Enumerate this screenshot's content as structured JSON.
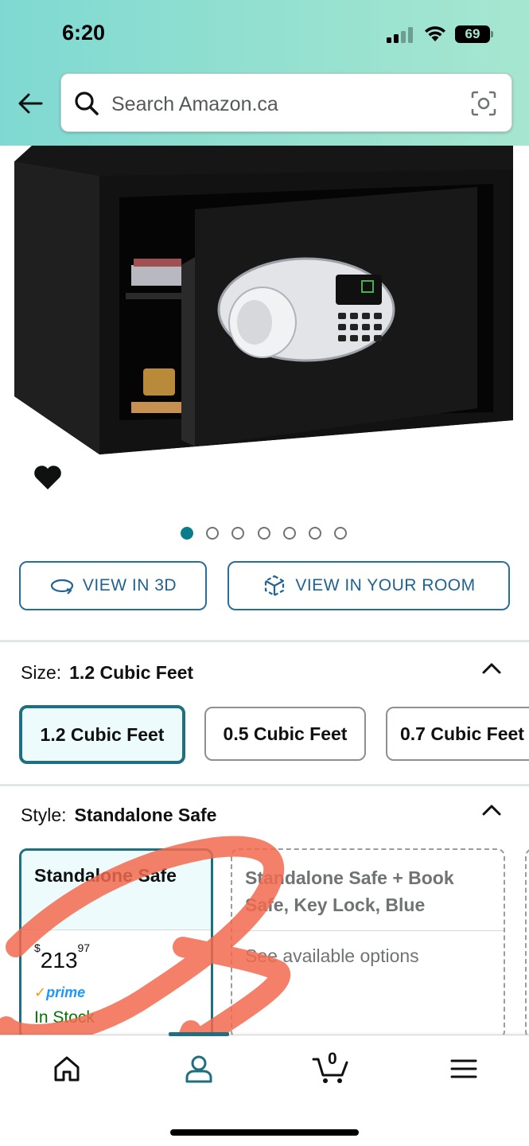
{
  "status_bar": {
    "time": "6:20",
    "battery": "69"
  },
  "search": {
    "placeholder": "Search Amazon.ca"
  },
  "gallery": {
    "total_images": 7,
    "active_index": 0
  },
  "actions": {
    "view_3d": "VIEW IN 3D",
    "view_room": "VIEW IN YOUR ROOM"
  },
  "size_section": {
    "label": "Size:",
    "selected": "1.2 Cubic Feet",
    "options": [
      "1.2 Cubic Feet",
      "0.5 Cubic Feet",
      "0.7 Cubic Feet"
    ]
  },
  "style_section": {
    "label": "Style:",
    "selected": "Standalone Safe",
    "options": [
      {
        "name": "Standalone Safe",
        "price_symbol": "$",
        "price_whole": "213",
        "price_fraction": "97",
        "prime": "prime",
        "stock": "In Stock"
      },
      {
        "name": "Standalone Safe + Book Safe, Key Lock, Blue",
        "note": "See available options"
      }
    ]
  },
  "tabbar": {
    "cart_count": "0",
    "active_tab": "account"
  },
  "colors": {
    "accent": "#1e6f80",
    "link": "#21628f",
    "annotation": "#f26a4f"
  }
}
